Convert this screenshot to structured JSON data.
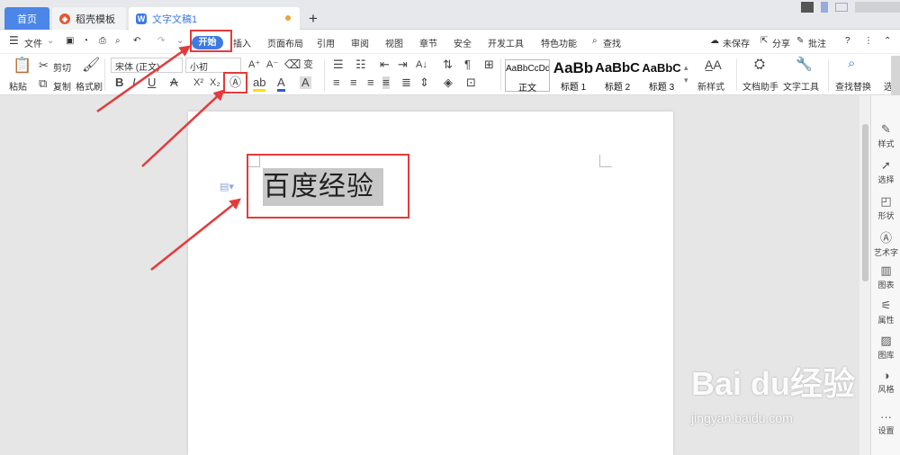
{
  "tabs": [
    {
      "label": "首页"
    },
    {
      "label": "稻壳模板"
    },
    {
      "label": "文字文稿1"
    }
  ],
  "menu": {
    "file": "文件",
    "start": "开始",
    "items": [
      "插入",
      "页面布局",
      "引用",
      "审阅",
      "视图",
      "章节",
      "安全",
      "开发工具",
      "特色功能"
    ],
    "search": "查找",
    "unsaved": "未保存",
    "share": "分享",
    "annotate": "批注"
  },
  "ribbon": {
    "paste": "粘贴",
    "cut": "剪切",
    "copy": "复制",
    "format_painter": "格式刷",
    "font_name": "宋体 (正文)",
    "font_size": "小初",
    "styles": [
      {
        "preview": "AaBbCcDd",
        "label": "正文"
      },
      {
        "preview": "AaBb",
        "label": "标题 1"
      },
      {
        "preview": "AaBbC",
        "label": "标题 2"
      },
      {
        "preview": "AaBbC",
        "label": "标题 3"
      }
    ],
    "new_style": "新样式",
    "doc_helper": "文档助手",
    "text_tools": "文字工具",
    "find_replace": "查找替换",
    "select_trunc": "选"
  },
  "document": {
    "text": "百度经验"
  },
  "sidebar": [
    "样式",
    "选择",
    "形状",
    "艺术字",
    "图表",
    "属性",
    "图库",
    "风格",
    "设置"
  ],
  "watermark": {
    "brand": "Bai du经验",
    "url": "jingyan.baidu.com"
  },
  "colors": {
    "accent": "#3d7be3",
    "annotation": "#e43a3a",
    "highlight_bg": "#c8c8c8"
  }
}
